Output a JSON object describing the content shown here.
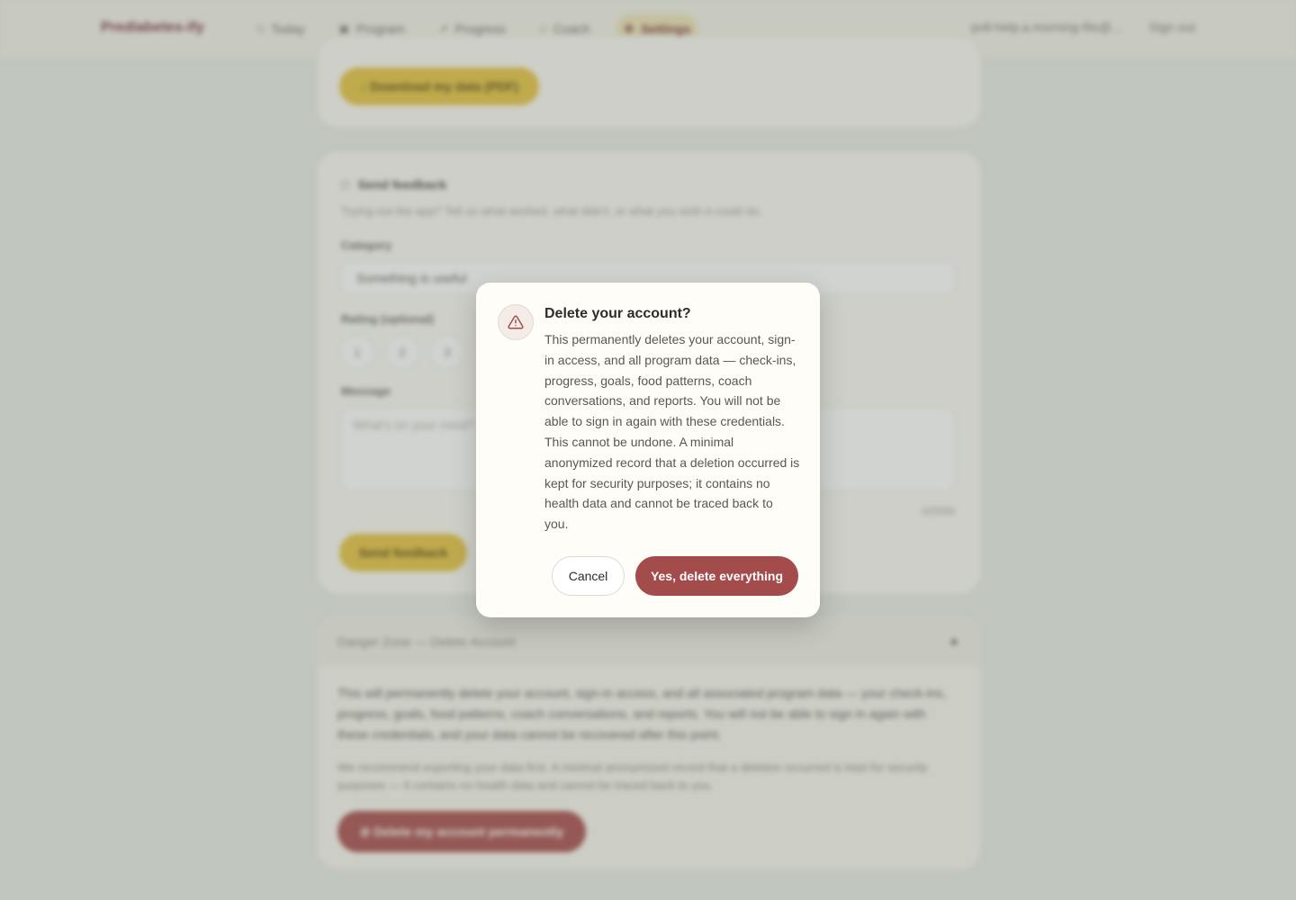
{
  "header": {
    "brand": "Prediabetes-ify",
    "nav": [
      {
        "label": "Today",
        "glyph": "□"
      },
      {
        "label": "Program",
        "glyph": "▣"
      },
      {
        "label": "Progress",
        "glyph": "↗"
      },
      {
        "label": "Coach",
        "glyph": "○"
      },
      {
        "label": "Settings",
        "glyph": "⚙"
      }
    ],
    "user": "poll-help.a.morning-fits@...",
    "sign_out": "Sign out"
  },
  "export_card": {
    "button_label": "↓  Download my data (PDF)"
  },
  "feedback_card": {
    "title": "Send feedback",
    "subtitle": "Trying out the app? Tell us what worked, what didn't, or what you wish it could do.",
    "category_label": "Category",
    "category_value": "Something is useful",
    "rating_label": "Rating (optional)",
    "ratings": [
      "1",
      "2",
      "3"
    ],
    "message_label": "Message",
    "message_placeholder": "What's on your mind?",
    "counter": "0/2000",
    "submit_label": "Send feedback"
  },
  "danger_card": {
    "title": "Danger Zone — Delete Account",
    "paragraph1": "This will permanently delete your account, sign-in access, and all associated program data — your check-ins, progress, goals, food patterns, coach conversations, and reports. You will not be able to sign in again with these credentials, and your data cannot be recovered after this point.",
    "paragraph2": "We recommend exporting your data first. A minimal anonymized record that a deletion occurred is kept for security purposes — it contains no health data and cannot be traced back to you.",
    "button_label": "⊘  Delete my account permanently"
  },
  "modal": {
    "icon": "warning-triangle-icon",
    "title": "Delete your account?",
    "body": "This permanently deletes your account, sign-in access, and all program data — check-ins, progress, goals, food patterns, coach conversations, and reports. You will not be able to sign in again with these credentials. This cannot be undone. A minimal anonymized record that a deletion occurred is kept for security purposes; it contains no health data and cannot be traced back to you.",
    "cancel_label": "Cancel",
    "confirm_label": "Yes, delete everything"
  },
  "colors": {
    "danger": "#a44b4c",
    "accent_yellow": "#e8c33f",
    "modal_bg": "#fffdf8"
  }
}
